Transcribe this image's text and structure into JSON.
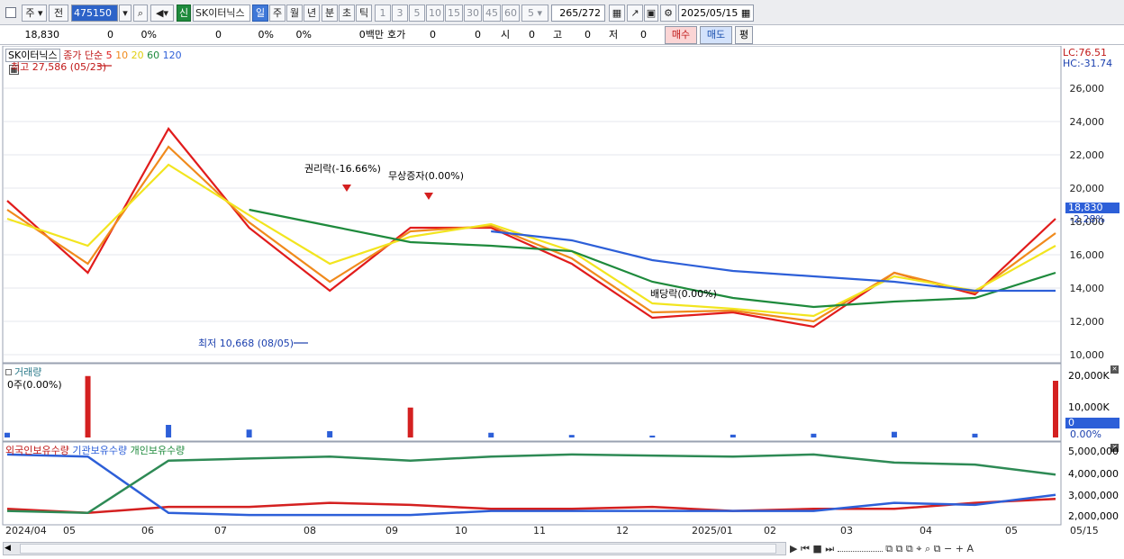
{
  "toolbar": {
    "period": "주",
    "prev": "전",
    "code": "475150",
    "new_badge": "신",
    "stock_name": "SK이터닉스",
    "tabs": [
      "일",
      "주",
      "월",
      "년",
      "분",
      "초",
      "틱"
    ],
    "active_tab": "일",
    "intervals": [
      "1",
      "3",
      "5",
      "10",
      "15",
      "30",
      "45",
      "60"
    ],
    "interval_select": "5",
    "count": "265",
    "count_total": "/272",
    "date": "2025/05/15"
  },
  "quote": {
    "price": "18,830",
    "v1": "0",
    "v2": "0%",
    "v3": "0",
    "v4": "0%",
    "v5": "0%",
    "amount": "0백만",
    "ask_label": "호가",
    "ask1": "0",
    "ask2": "0",
    "open_label": "시",
    "open": "0",
    "high_label": "고",
    "high": "0",
    "low_label": "저",
    "low": "0",
    "buy": "매수",
    "sell": "매도",
    "eval": "평"
  },
  "price_panel": {
    "legend_name": "SK이터닉스",
    "legend_ma": "종가 단순",
    "ma_periods": [
      "5",
      "10",
      "20",
      "60",
      "120"
    ],
    "ma_colors": [
      "#e11c1c",
      "#f08a1c",
      "#f2e51f",
      "#1e8a3c",
      "#2d5fd8"
    ],
    "high_marker": "최고 27,586 (05/23)",
    "low_marker": "최저 10,668 (08/05)",
    "annotations": [
      "권리락(-16.66%)",
      "무상증자(0.00%)",
      "배당락(0.00%)"
    ],
    "lc": "LC:76.51",
    "hc": "HC:-31.74",
    "current_price": "18,830",
    "current_change": "-2.28%",
    "y_ticks": [
      "26,000",
      "24,000",
      "22,000",
      "20,000",
      "18,000",
      "16,000",
      "14,000",
      "12,000",
      "10,000"
    ]
  },
  "volume_panel": {
    "title": "거래량",
    "sub": "0주(0.00%)",
    "y_ticks": [
      "20,000K",
      "10,000K"
    ],
    "current": "0",
    "current_pct": "0.00%"
  },
  "holdings_panel": {
    "legend": [
      "외국인보유수량",
      "기관보유수량",
      "개인보유수량"
    ],
    "y_ticks": [
      "5,000,000",
      "4,000,000",
      "3,000,000",
      "2,000,000"
    ]
  },
  "x_axis": [
    "2024/04",
    "05",
    "06",
    "07",
    "08",
    "09",
    "10",
    "11",
    "12",
    "2025/01",
    "02",
    "03",
    "04",
    "05",
    "05/15"
  ],
  "chart_data": [
    {
      "type": "line",
      "title": "",
      "ylabel": "",
      "ylim": [
        10000,
        27000
      ],
      "x": [
        "2024/04",
        "05",
        "06",
        "07",
        "08",
        "09",
        "10",
        "11",
        "12",
        "2025/01",
        "02",
        "03",
        "04",
        "05"
      ],
      "series": [
        {
          "name": "5",
          "values": [
            19000,
            15000,
            23000,
            17500,
            14000,
            17500,
            17500,
            15500,
            12500,
            12800,
            12000,
            15000,
            13800,
            18000
          ]
        },
        {
          "name": "10",
          "values": [
            18500,
            15500,
            22000,
            17800,
            14500,
            17300,
            17600,
            15800,
            12800,
            12900,
            12300,
            15000,
            13900,
            17200
          ]
        },
        {
          "name": "20",
          "values": [
            18000,
            16500,
            21000,
            18200,
            15500,
            17000,
            17700,
            16200,
            13300,
            13000,
            12600,
            14800,
            14000,
            16500
          ]
        },
        {
          "name": "60",
          "values": [
            null,
            null,
            null,
            18500,
            17600,
            16700,
            16500,
            16200,
            14500,
            13600,
            13100,
            13400,
            13600,
            15000
          ]
        },
        {
          "name": "120",
          "values": [
            null,
            null,
            null,
            null,
            null,
            null,
            17300,
            16800,
            15700,
            15100,
            14800,
            14500,
            14000,
            14000
          ]
        }
      ]
    },
    {
      "type": "bar",
      "title": "",
      "ylabel": "",
      "ylim": [
        0,
        20000
      ],
      "x": [
        "2024/04",
        "05",
        "06",
        "07",
        "08",
        "09",
        "10",
        "11",
        "12",
        "2025/01",
        "02",
        "03",
        "04",
        "05"
      ],
      "series": [
        {
          "name": "거래량",
          "values": [
            1500,
            19500,
            4000,
            2500,
            2000,
            9500,
            1500,
            800,
            600,
            900,
            1200,
            1800,
            1200,
            18000
          ]
        }
      ]
    },
    {
      "type": "line",
      "title": "",
      "ylabel": "",
      "ylim": [
        1500000,
        5300000
      ],
      "x": [
        "2024/04",
        "05",
        "06",
        "07",
        "08",
        "09",
        "10",
        "11",
        "12",
        "2025/01",
        "02",
        "03",
        "04",
        "05"
      ],
      "series": [
        {
          "name": "외국인보유수량",
          "values": [
            2200000,
            2000000,
            2300000,
            2300000,
            2500000,
            2400000,
            2200000,
            2200000,
            2300000,
            2100000,
            2200000,
            2200000,
            2500000,
            2700000
          ]
        },
        {
          "name": "기관보유수량",
          "values": [
            4900000,
            4800000,
            2000000,
            1900000,
            1900000,
            1900000,
            2100000,
            2100000,
            2100000,
            2100000,
            2100000,
            2500000,
            2400000,
            2900000
          ]
        },
        {
          "name": "개인보유수량",
          "values": [
            2100000,
            2000000,
            4600000,
            4700000,
            4800000,
            4600000,
            4800000,
            4900000,
            4850000,
            4800000,
            4900000,
            4500000,
            4400000,
            3900000
          ]
        }
      ]
    }
  ]
}
